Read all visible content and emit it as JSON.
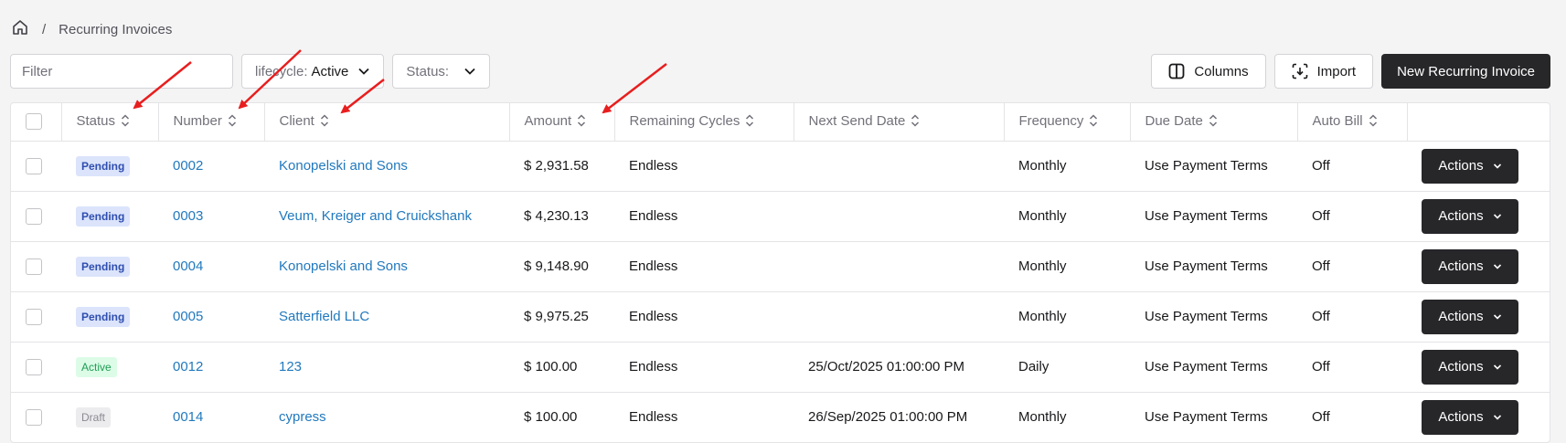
{
  "breadcrumb": {
    "separator": "/",
    "current": "Recurring Invoices"
  },
  "toolbar": {
    "filter_placeholder": "Filter",
    "lifecycle_label": "lifecycle:",
    "lifecycle_value": "Active",
    "status_label": "Status:",
    "columns_label": "Columns",
    "import_label": "Import",
    "new_label": "New Recurring Invoice"
  },
  "table": {
    "headers": [
      "Status",
      "Number",
      "Client",
      "Amount",
      "Remaining Cycles",
      "Next Send Date",
      "Frequency",
      "Due Date",
      "Auto Bill"
    ],
    "action_label": "Actions",
    "rows": [
      {
        "status": "Pending",
        "number": "0002",
        "client": "Konopelski and Sons",
        "amount": "$ 2,931.58",
        "remaining": "Endless",
        "next_send": "",
        "frequency": "Monthly",
        "due_date": "Use Payment Terms",
        "auto_bill": "Off"
      },
      {
        "status": "Pending",
        "number": "0003",
        "client": "Veum, Kreiger and Cruickshank",
        "amount": "$ 4,230.13",
        "remaining": "Endless",
        "next_send": "",
        "frequency": "Monthly",
        "due_date": "Use Payment Terms",
        "auto_bill": "Off"
      },
      {
        "status": "Pending",
        "number": "0004",
        "client": "Konopelski and Sons",
        "amount": "$ 9,148.90",
        "remaining": "Endless",
        "next_send": "",
        "frequency": "Monthly",
        "due_date": "Use Payment Terms",
        "auto_bill": "Off"
      },
      {
        "status": "Pending",
        "number": "0005",
        "client": "Satterfield LLC",
        "amount": "$ 9,975.25",
        "remaining": "Endless",
        "next_send": "",
        "frequency": "Monthly",
        "due_date": "Use Payment Terms",
        "auto_bill": "Off"
      },
      {
        "status": "Active",
        "number": "0012",
        "client": "123",
        "amount": "$ 100.00",
        "remaining": "Endless",
        "next_send": "25/Oct/2025 01:00:00 PM",
        "frequency": "Daily",
        "due_date": "Use Payment Terms",
        "auto_bill": "Off"
      },
      {
        "status": "Draft",
        "number": "0014",
        "client": "cypress",
        "amount": "$ 100.00",
        "remaining": "Endless",
        "next_send": "26/Sep/2025 01:00:00 PM",
        "frequency": "Monthly",
        "due_date": "Use Payment Terms",
        "auto_bill": "Off"
      }
    ]
  },
  "colors": {
    "link": "#2179be",
    "dark_button": "#27272a",
    "annotation_arrow": "#e81e1e"
  }
}
